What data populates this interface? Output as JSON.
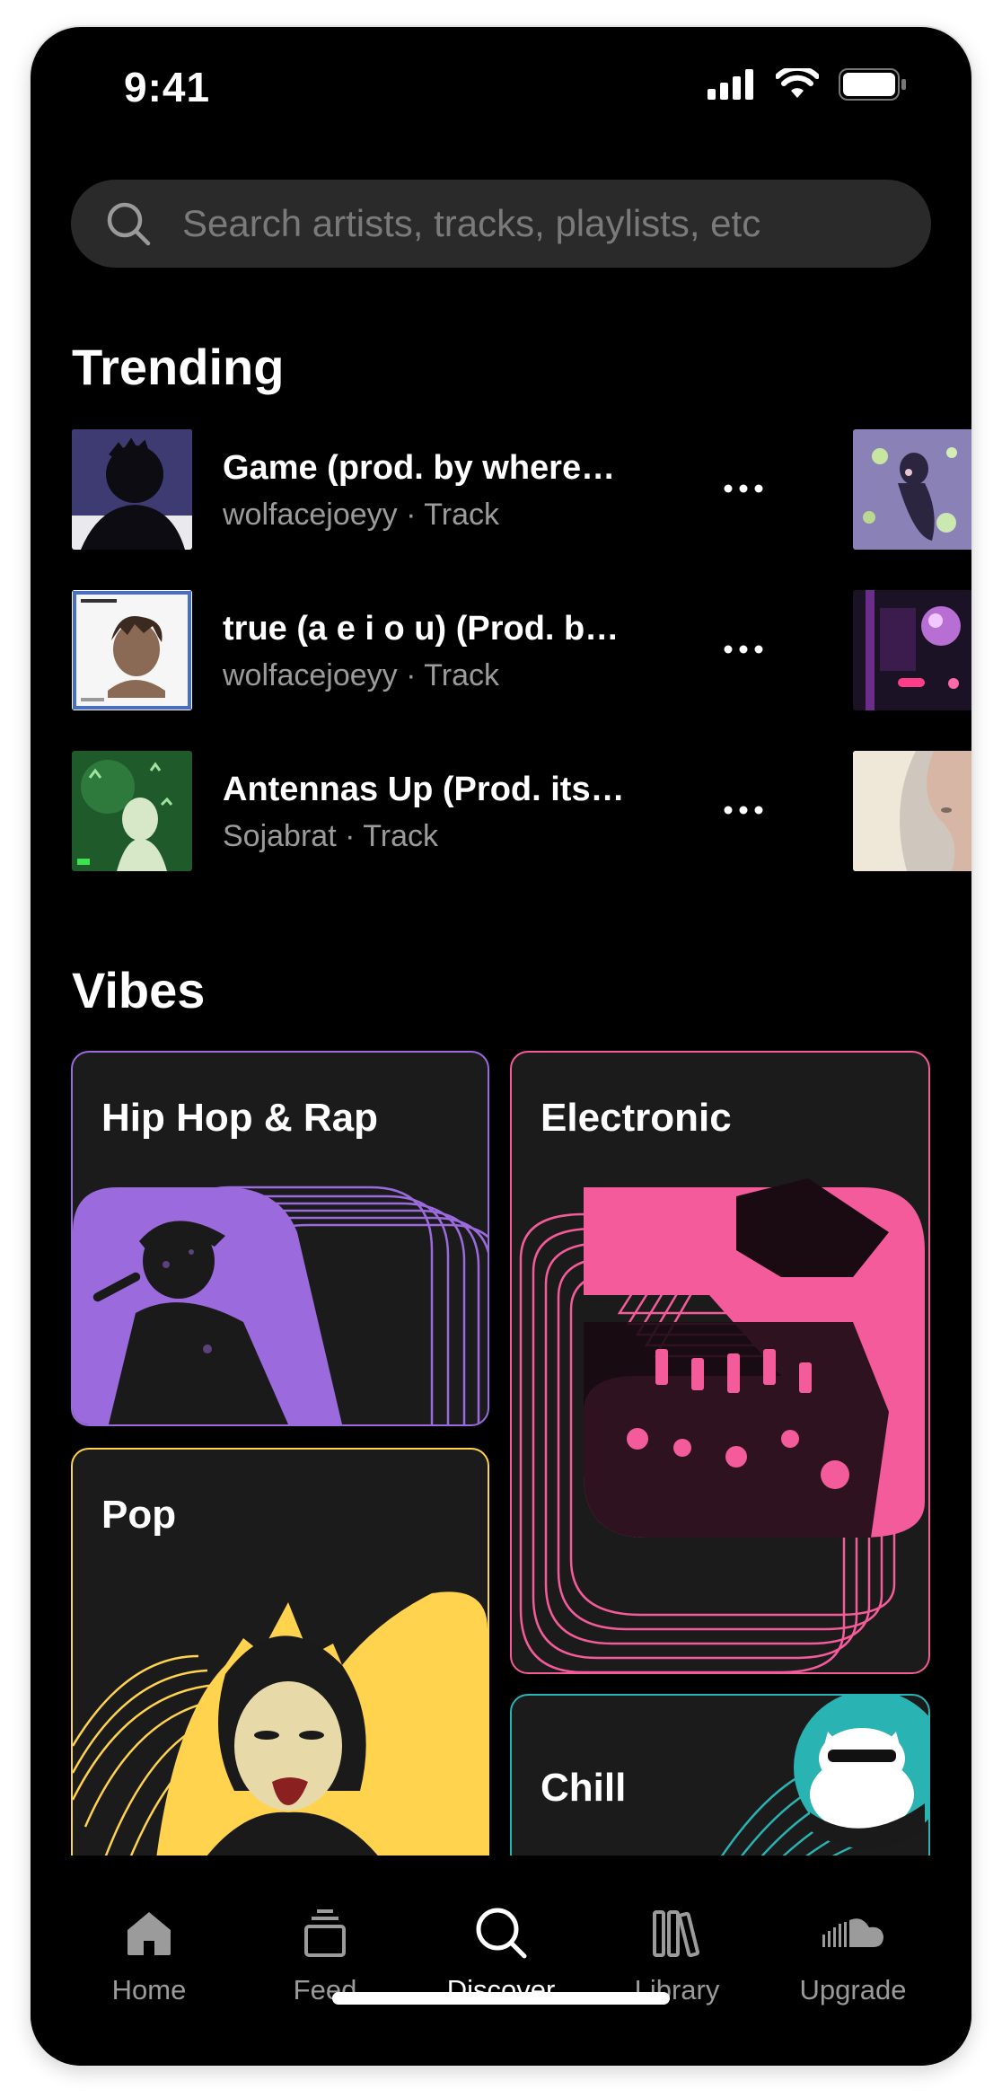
{
  "status": {
    "time": "9:41"
  },
  "search": {
    "placeholder": "Search artists, tracks, playlists, etc"
  },
  "trending": {
    "title": "Trending",
    "items": [
      {
        "title": "Game (prod. by where…",
        "artist": "wolfacejoeyy",
        "type": "Track"
      },
      {
        "title": "true (a e i o u) (Prod. b…",
        "artist": "wolfacejoeyy",
        "type": "Track"
      },
      {
        "title": "Antennas Up (Prod. its…",
        "artist": "Sojabrat",
        "type": "Track"
      }
    ],
    "separator": "·"
  },
  "vibes": {
    "title": "Vibes",
    "items": [
      {
        "label": "Hip Hop & Rap",
        "color": "#9b6bde"
      },
      {
        "label": "Electronic",
        "color": "#f45b9a"
      },
      {
        "label": "Pop",
        "color": "#ffd34e"
      },
      {
        "label": "Chill",
        "color": "#29b3b3"
      }
    ]
  },
  "tabs": [
    {
      "label": "Home",
      "icon": "home-icon"
    },
    {
      "label": "Feed",
      "icon": "feed-icon"
    },
    {
      "label": "Discover",
      "icon": "discover-icon",
      "active": true
    },
    {
      "label": "Library",
      "icon": "library-icon"
    },
    {
      "label": "Upgrade",
      "icon": "soundcloud-icon"
    }
  ]
}
